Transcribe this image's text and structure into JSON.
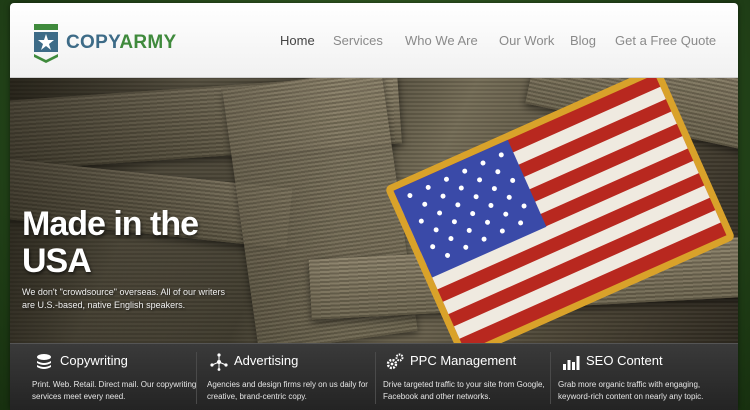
{
  "brand": {
    "copy": "COPY",
    "army": "ARMY"
  },
  "nav": {
    "items": [
      "Home",
      "Services",
      "Who We Are",
      "Our Work",
      "Blog",
      "Get a Free Quote"
    ],
    "active": "Home"
  },
  "hero": {
    "title": "Made in the USA",
    "text": "We don't \"crowdsource\" overseas. All of our writers are U.S.-based, native English speakers."
  },
  "services": [
    {
      "icon": "stack-icon",
      "title": "Copywriting",
      "desc": "Print. Web. Retail. Direct mail. Our copywriting services meet every need."
    },
    {
      "icon": "network-icon",
      "title": "Advertising",
      "desc": "Agencies and design firms rely on us daily for creative, brand-centric copy."
    },
    {
      "icon": "gears-icon",
      "title": "PPC Management",
      "desc": "Drive targeted traffic to your site from Google, Facebook and other networks."
    },
    {
      "icon": "bar-chart-icon",
      "title": "SEO Content",
      "desc": "Grab more organic traffic with engaging, keyword-rich content on nearly any topic."
    }
  ],
  "colors": {
    "brand_blue": "#3d6b87",
    "brand_green": "#3f8a3c",
    "background": "#24461a"
  }
}
